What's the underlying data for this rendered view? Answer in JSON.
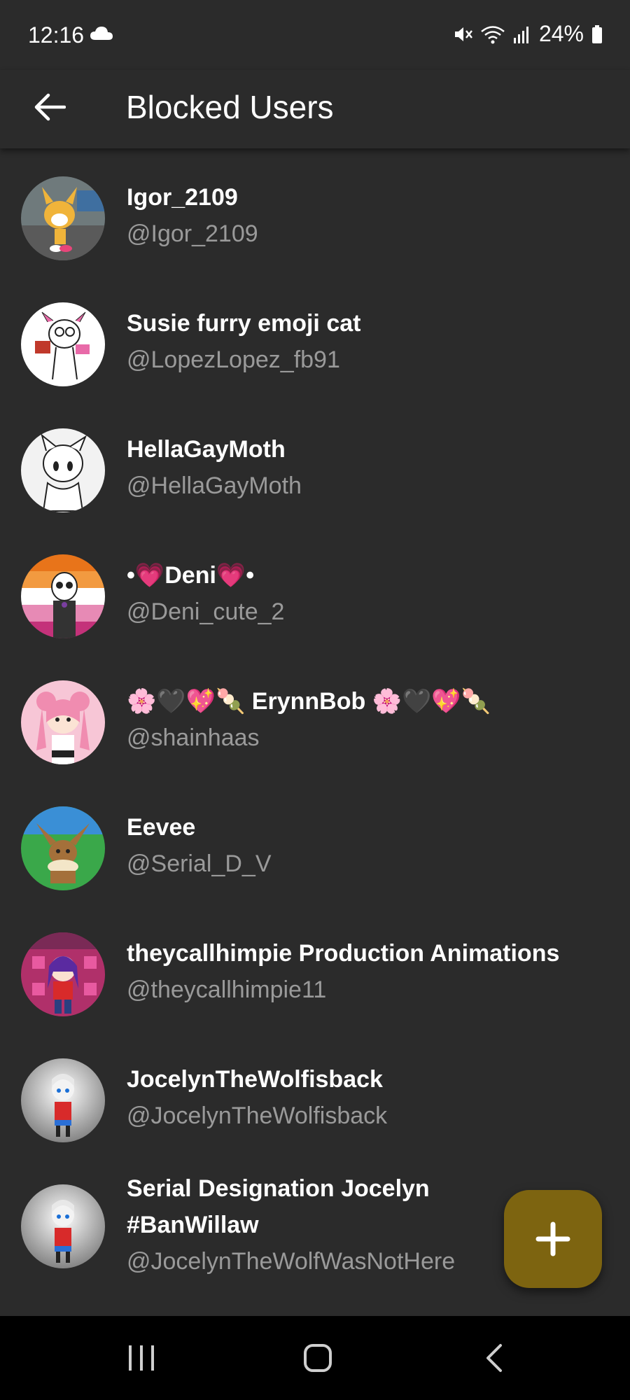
{
  "status_bar": {
    "time": "12:16",
    "battery": "24%",
    "icons": [
      "cloud-icon",
      "mute-icon",
      "wifi-icon",
      "signal-icon",
      "battery-icon"
    ]
  },
  "header": {
    "title": "Blocked Users",
    "back_icon": "arrow-left-icon"
  },
  "users": [
    {
      "name": "Igor_2109",
      "handle": "@Igor_2109"
    },
    {
      "name": "Susie furry emoji cat",
      "handle": "@LopezLopez_fb91"
    },
    {
      "name": "HellaGayMoth",
      "handle": "@HellaGayMoth"
    },
    {
      "name": "•💗Deni💗•",
      "handle": "@Deni_cute_2"
    },
    {
      "name": "🌸🖤💖🍡 ErynnBob 🌸🖤💖🍡",
      "handle": "@shainhaas"
    },
    {
      "name": "Eevee",
      "handle": "@Serial_D_V"
    },
    {
      "name": "theycallhimpie Production Animations",
      "handle": "@theycallhimpie11"
    },
    {
      "name": "JocelynTheWolfisback",
      "handle": "@JocelynTheWolfisback"
    },
    {
      "name": "Serial Designation Jocelyn #BanWillaw",
      "handle": "@JocelynTheWolfWasNotHere"
    }
  ],
  "fab": {
    "icon": "plus-icon"
  },
  "nav": {
    "icons": [
      "recents-icon",
      "home-icon",
      "back-icon"
    ]
  },
  "colors": {
    "background": "#2b2b2b",
    "fab": "#7d6410",
    "handle_text": "#9a9a9a",
    "nav_bar": "#000000"
  }
}
